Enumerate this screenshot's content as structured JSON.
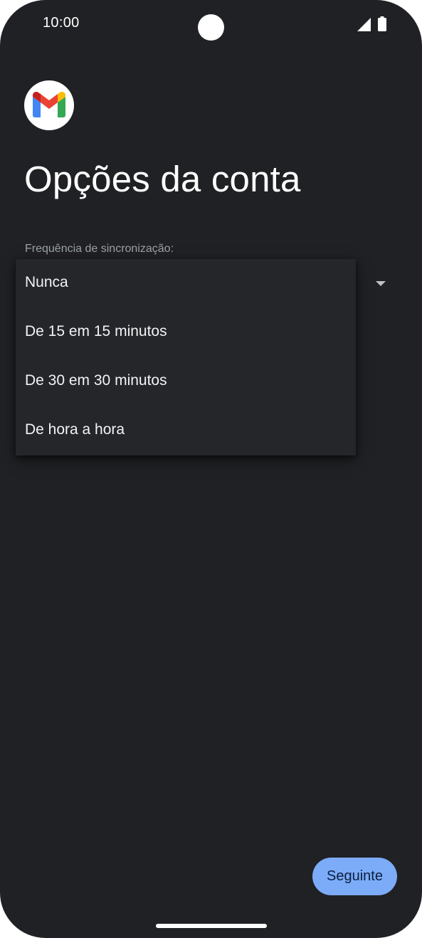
{
  "status_bar": {
    "time": "10:00",
    "icons": [
      "signal-icon",
      "battery-icon"
    ]
  },
  "app": {
    "logo_icon": "gmail-logo-icon"
  },
  "page": {
    "title": "Opções da conta"
  },
  "sync_field": {
    "label": "Frequência de sincronização:",
    "selected": "Nunca",
    "options": [
      "Nunca",
      "De 15 em 15 minutos",
      "De 30 em 30 minutos",
      "De hora a hora"
    ]
  },
  "footer": {
    "next_label": "Seguinte"
  },
  "colors": {
    "background": "#202124",
    "menu_background": "#25262a",
    "primary_button": "#7cacf8",
    "gmail_red": "#EA4335",
    "gmail_blue": "#4285F4",
    "gmail_green": "#34A853",
    "gmail_yellow": "#FBBC04"
  }
}
